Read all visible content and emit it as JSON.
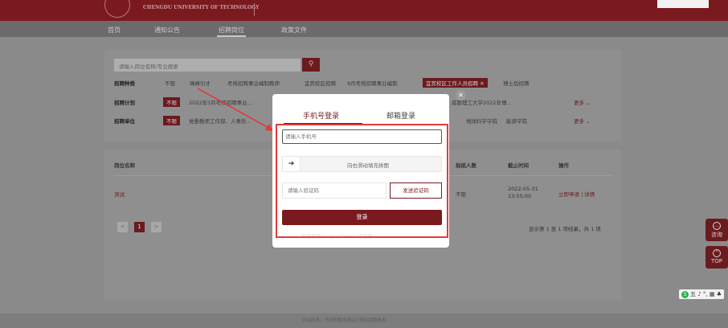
{
  "header": {
    "logo_text": "CHENGDU UNIVERSITY OF TECHNOLOGY"
  },
  "nav": {
    "items": [
      "首页",
      "通知公告",
      "招聘岗位",
      "政策文件"
    ]
  },
  "search": {
    "placeholder": "请输入岗位名称/专业搜索",
    "button_icon": "search-icon"
  },
  "filters": {
    "recruit_type": {
      "label": "招聘种类",
      "options": [
        "不限",
        "珠峰引才",
        "考核招聘事业编制教师",
        "宜宾校区招聘",
        "9月考核招聘事业编制",
        "宜宾校区工作人员招聘",
        "博士后招聘"
      ],
      "selected": "宜宾校区工作人员招聘",
      "selected_close_icon": "close-icon"
    },
    "recruit_plan": {
      "label": "招聘计划",
      "selected": "不限",
      "options": [
        "2022年5月考核招聘事业...",
        "成都理工大学2022年博..."
      ],
      "more": "更多"
    },
    "recruit_unit": {
      "label": "招聘单位",
      "selected": "不限",
      "options": [
        "党委教师工作部、人事处...",
        "地球科学学院",
        "能源学院"
      ],
      "more": "更多"
    }
  },
  "results": {
    "headers": [
      "岗位名称",
      "拟招人数",
      "截止时间",
      "操作"
    ],
    "rows": [
      {
        "name": "测试",
        "count": "不限",
        "deadline_date": "2022-05-31",
        "deadline_time": "13:55:00",
        "action": "立即申请 | 详情"
      }
    ],
    "pagination": {
      "prev": "<",
      "current": "1",
      "next": ">"
    },
    "summary": "显示第 1 至 1 项结果，共 1 项"
  },
  "footer": {
    "text": "本站所发，不得转载本网站之所有招聘信息"
  },
  "side_buttons": [
    {
      "label": "咨询",
      "icon": "chat-icon"
    },
    {
      "label": "TOP",
      "icon": "arrow-up-icon"
    }
  ],
  "ime": {
    "label": "五 ♪ °, ▦ ♣"
  },
  "modal": {
    "tab_phone": "手机号登录",
    "tab_email": "邮箱登录",
    "phone_placeholder": "请输入手机号",
    "slider_text": "向右滑动填充拼图",
    "code_placeholder": "请输入验证码",
    "send_code": "发送验证码",
    "login": "登录",
    "hint": "推荐使用Google Chrome浏览器",
    "close_icon": "close-icon"
  },
  "colors": {
    "brand": "#7a1a1f",
    "annotation_red": "#e53a3a"
  }
}
